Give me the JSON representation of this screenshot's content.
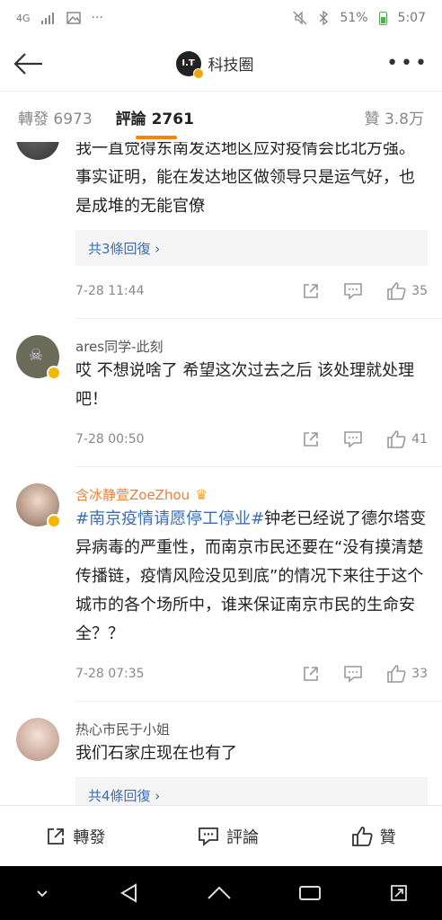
{
  "status_bar": {
    "signal": "4G",
    "battery": "51%",
    "time": "5:07"
  },
  "header": {
    "logo_text": "I.T",
    "title": "科技圈"
  },
  "tabs": {
    "repost": "轉發 6973",
    "comments": "評論 2761",
    "likes": "贊 3.8万"
  },
  "comments": [
    {
      "text": "我一直觉得东南发达地区应对疫情会比北方强。事实证明，能在发达地区做领导只是运气好，也是成堆的无能官僚",
      "replies": "共3條回復 ›",
      "date": "7-28 11:44",
      "likes": "35"
    },
    {
      "name": "ares同学-此刻",
      "text": "哎 不想说啥了 希望这次过去之后 该处理就处理吧！",
      "date": "7-28 00:50",
      "likes": "41"
    },
    {
      "name": "含冰静萱ZoeZhou",
      "hashtag": "#南京疫情请愿停工停业#",
      "text": "钟老已经说了德尔塔变异病毒的严重性，而南京市民还要在“没有摸清楚传播链，疫情风险没见到底”的情况下来往于这个城市的各个场所中，谁来保证南京市民的生命安全？？",
      "date": "7-28 07:35",
      "likes": "33"
    },
    {
      "name": "热心市民于小姐",
      "text": "我们石家庄现在也有了",
      "replies": "共4條回復 ›"
    }
  ],
  "bottom_bar": {
    "repost": "轉發",
    "comment": "評論",
    "like": "贊"
  },
  "colors": {
    "accent": "#ff8200",
    "link": "#3b6eb4",
    "name_highlight": "#e9803a"
  }
}
